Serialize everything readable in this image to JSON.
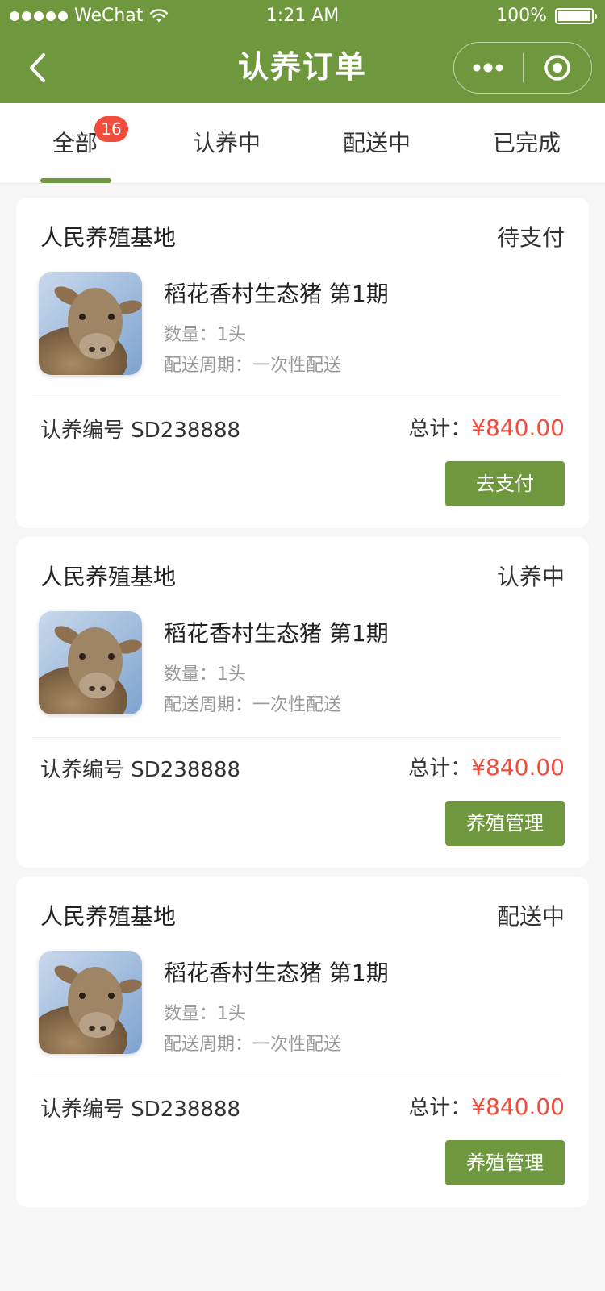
{
  "status_bar": {
    "carrier": "WeChat",
    "time": "1:21 AM",
    "battery": "100%"
  },
  "nav": {
    "title": "认养订单"
  },
  "tabs": [
    {
      "label": "全部",
      "badge": "16",
      "active": true
    },
    {
      "label": "认养中",
      "active": false
    },
    {
      "label": "配送中",
      "active": false
    },
    {
      "label": "已完成",
      "active": false
    }
  ],
  "orders": [
    {
      "farm": "人民养殖基地",
      "status": "待支付",
      "product": "稻花香村生态猪 第1期",
      "quantity": "数量：1头",
      "cycle": "配送周期：一次性配送",
      "order_no": "认养编号 SD238888",
      "total_label": "总计：",
      "total": "¥840.00",
      "action": "去支付"
    },
    {
      "farm": "人民养殖基地",
      "status": "认养中",
      "product": "稻花香村生态猪 第1期",
      "quantity": "数量：1头",
      "cycle": "配送周期：一次性配送",
      "order_no": "认养编号 SD238888",
      "total_label": "总计：",
      "total": "¥840.00",
      "action": "养殖管理"
    },
    {
      "farm": "人民养殖基地",
      "status": "配送中",
      "product": "稻花香村生态猪 第1期",
      "quantity": "数量：1头",
      "cycle": "配送周期：一次性配送",
      "order_no": "认养编号 SD238888",
      "total_label": "总计：",
      "total": "¥840.00",
      "action": "养殖管理"
    }
  ],
  "colors": {
    "brand": "#6f983e",
    "price": "#f24c3c",
    "badge": "#f24c3c"
  },
  "icons": {
    "back": "chevron-left-icon",
    "more": "more-dots-icon",
    "close": "target-circle-icon",
    "thumb": "sheep-photo"
  }
}
